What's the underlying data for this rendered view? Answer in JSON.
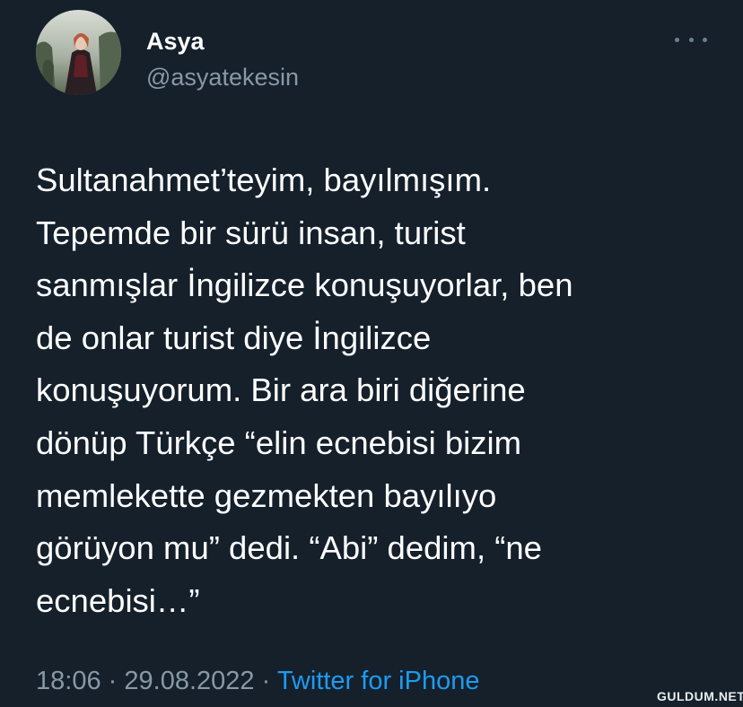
{
  "tweet": {
    "author": {
      "name": "Asya",
      "handle": "@asyatekesin",
      "avatar_icon": "profile-photo"
    },
    "more_icon": "more-options-icon",
    "text": "Sultanahmet’teyim, bayılmışım.\nTepemde bir sürü insan, turist\nsanmışlar İngilizce konuşuyorlar, ben\nde onlar turist diye İngilizce\nkonuşuyorum. Bir ara biri diğerine\ndönüp Türkçe “elin ecnebisi bizim\nmemlekette gezmekten bayılıyo\ngörüyon mu” dedi. “Abi” dedim, “ne\necnebisi…”",
    "time": "18:06",
    "separator": "·",
    "date": "29.08.2022",
    "source": "Twitter for iPhone"
  },
  "watermark": "GULDUM.NET",
  "colors": {
    "background": "#15202b",
    "text": "#ffffff",
    "muted": "#8899a6",
    "link": "#1d9bf0"
  }
}
